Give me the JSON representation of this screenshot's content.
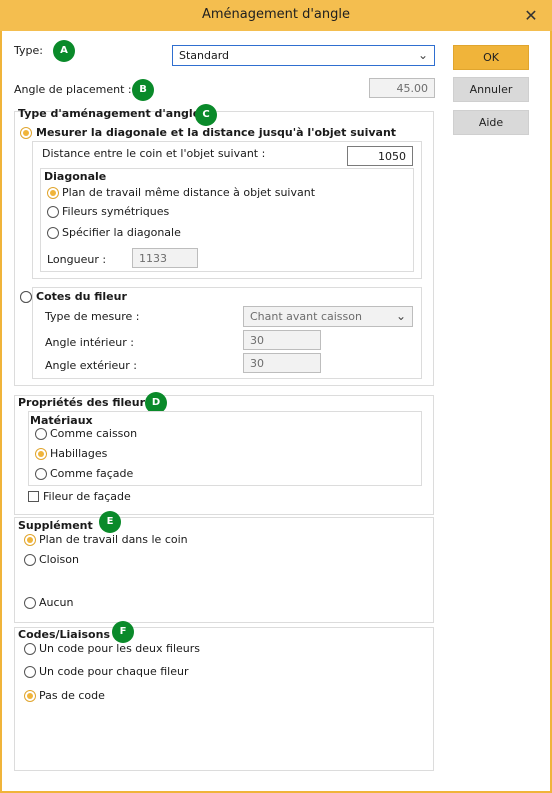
{
  "window": {
    "title": "Aménagement d'angle",
    "close_glyph": "✕"
  },
  "top": {
    "type_label": "Type:",
    "type_value": "Standard",
    "angle_label": "Angle de placement :",
    "angle_value": "45.00"
  },
  "buttons": {
    "ok": "OK",
    "cancel": "Annuler",
    "help": "Aide"
  },
  "type_amenagement": {
    "title": "Type d'aménagement d'angle",
    "mesurer_label": "Mesurer la diagonale et la distance jusqu'à l'objet suivant",
    "distance_label": "Distance entre le coin et l'objet suivant :",
    "distance_value": "1050",
    "diagonale_title": "Diagonale",
    "opt_plan": "Plan de travail même distance à objet suivant",
    "opt_sym": "Fileurs symétriques",
    "opt_spec": "Spécifier la diagonale",
    "longueur_label": "Longueur :",
    "longueur_value": "1133",
    "cotes_label": "Cotes du fileur",
    "type_mesure_label": "Type de mesure :",
    "type_mesure_value": "Chant avant caisson",
    "angle_int_label": "Angle intérieur :",
    "angle_int_value": "30",
    "angle_ext_label": "Angle extérieur :",
    "angle_ext_value": "30"
  },
  "proprietes": {
    "title": "Propriétés des fileurs",
    "materiaux_title": "Matériaux",
    "opt_caisson": "Comme caisson",
    "opt_habillages": "Habillages",
    "opt_facade": "Comme façade",
    "fileur_facade": "Fileur de façade"
  },
  "supplement": {
    "title": "Supplément",
    "opt_plan": "Plan de travail dans le coin",
    "opt_cloison": "Cloison",
    "opt_aucun": "Aucun"
  },
  "codes": {
    "title": "Codes/Liaisons",
    "opt_deux": "Un code pour les deux fileurs",
    "opt_chaque": "Un code pour chaque fileur",
    "opt_pas": "Pas de code"
  },
  "badges": {
    "a": "A",
    "b": "B",
    "c": "C",
    "d": "D",
    "e": "E",
    "f": "F"
  },
  "colors": {
    "accent": "#f0b43a",
    "badge": "#0a8a2a",
    "select_border": "#2f6fd0"
  }
}
